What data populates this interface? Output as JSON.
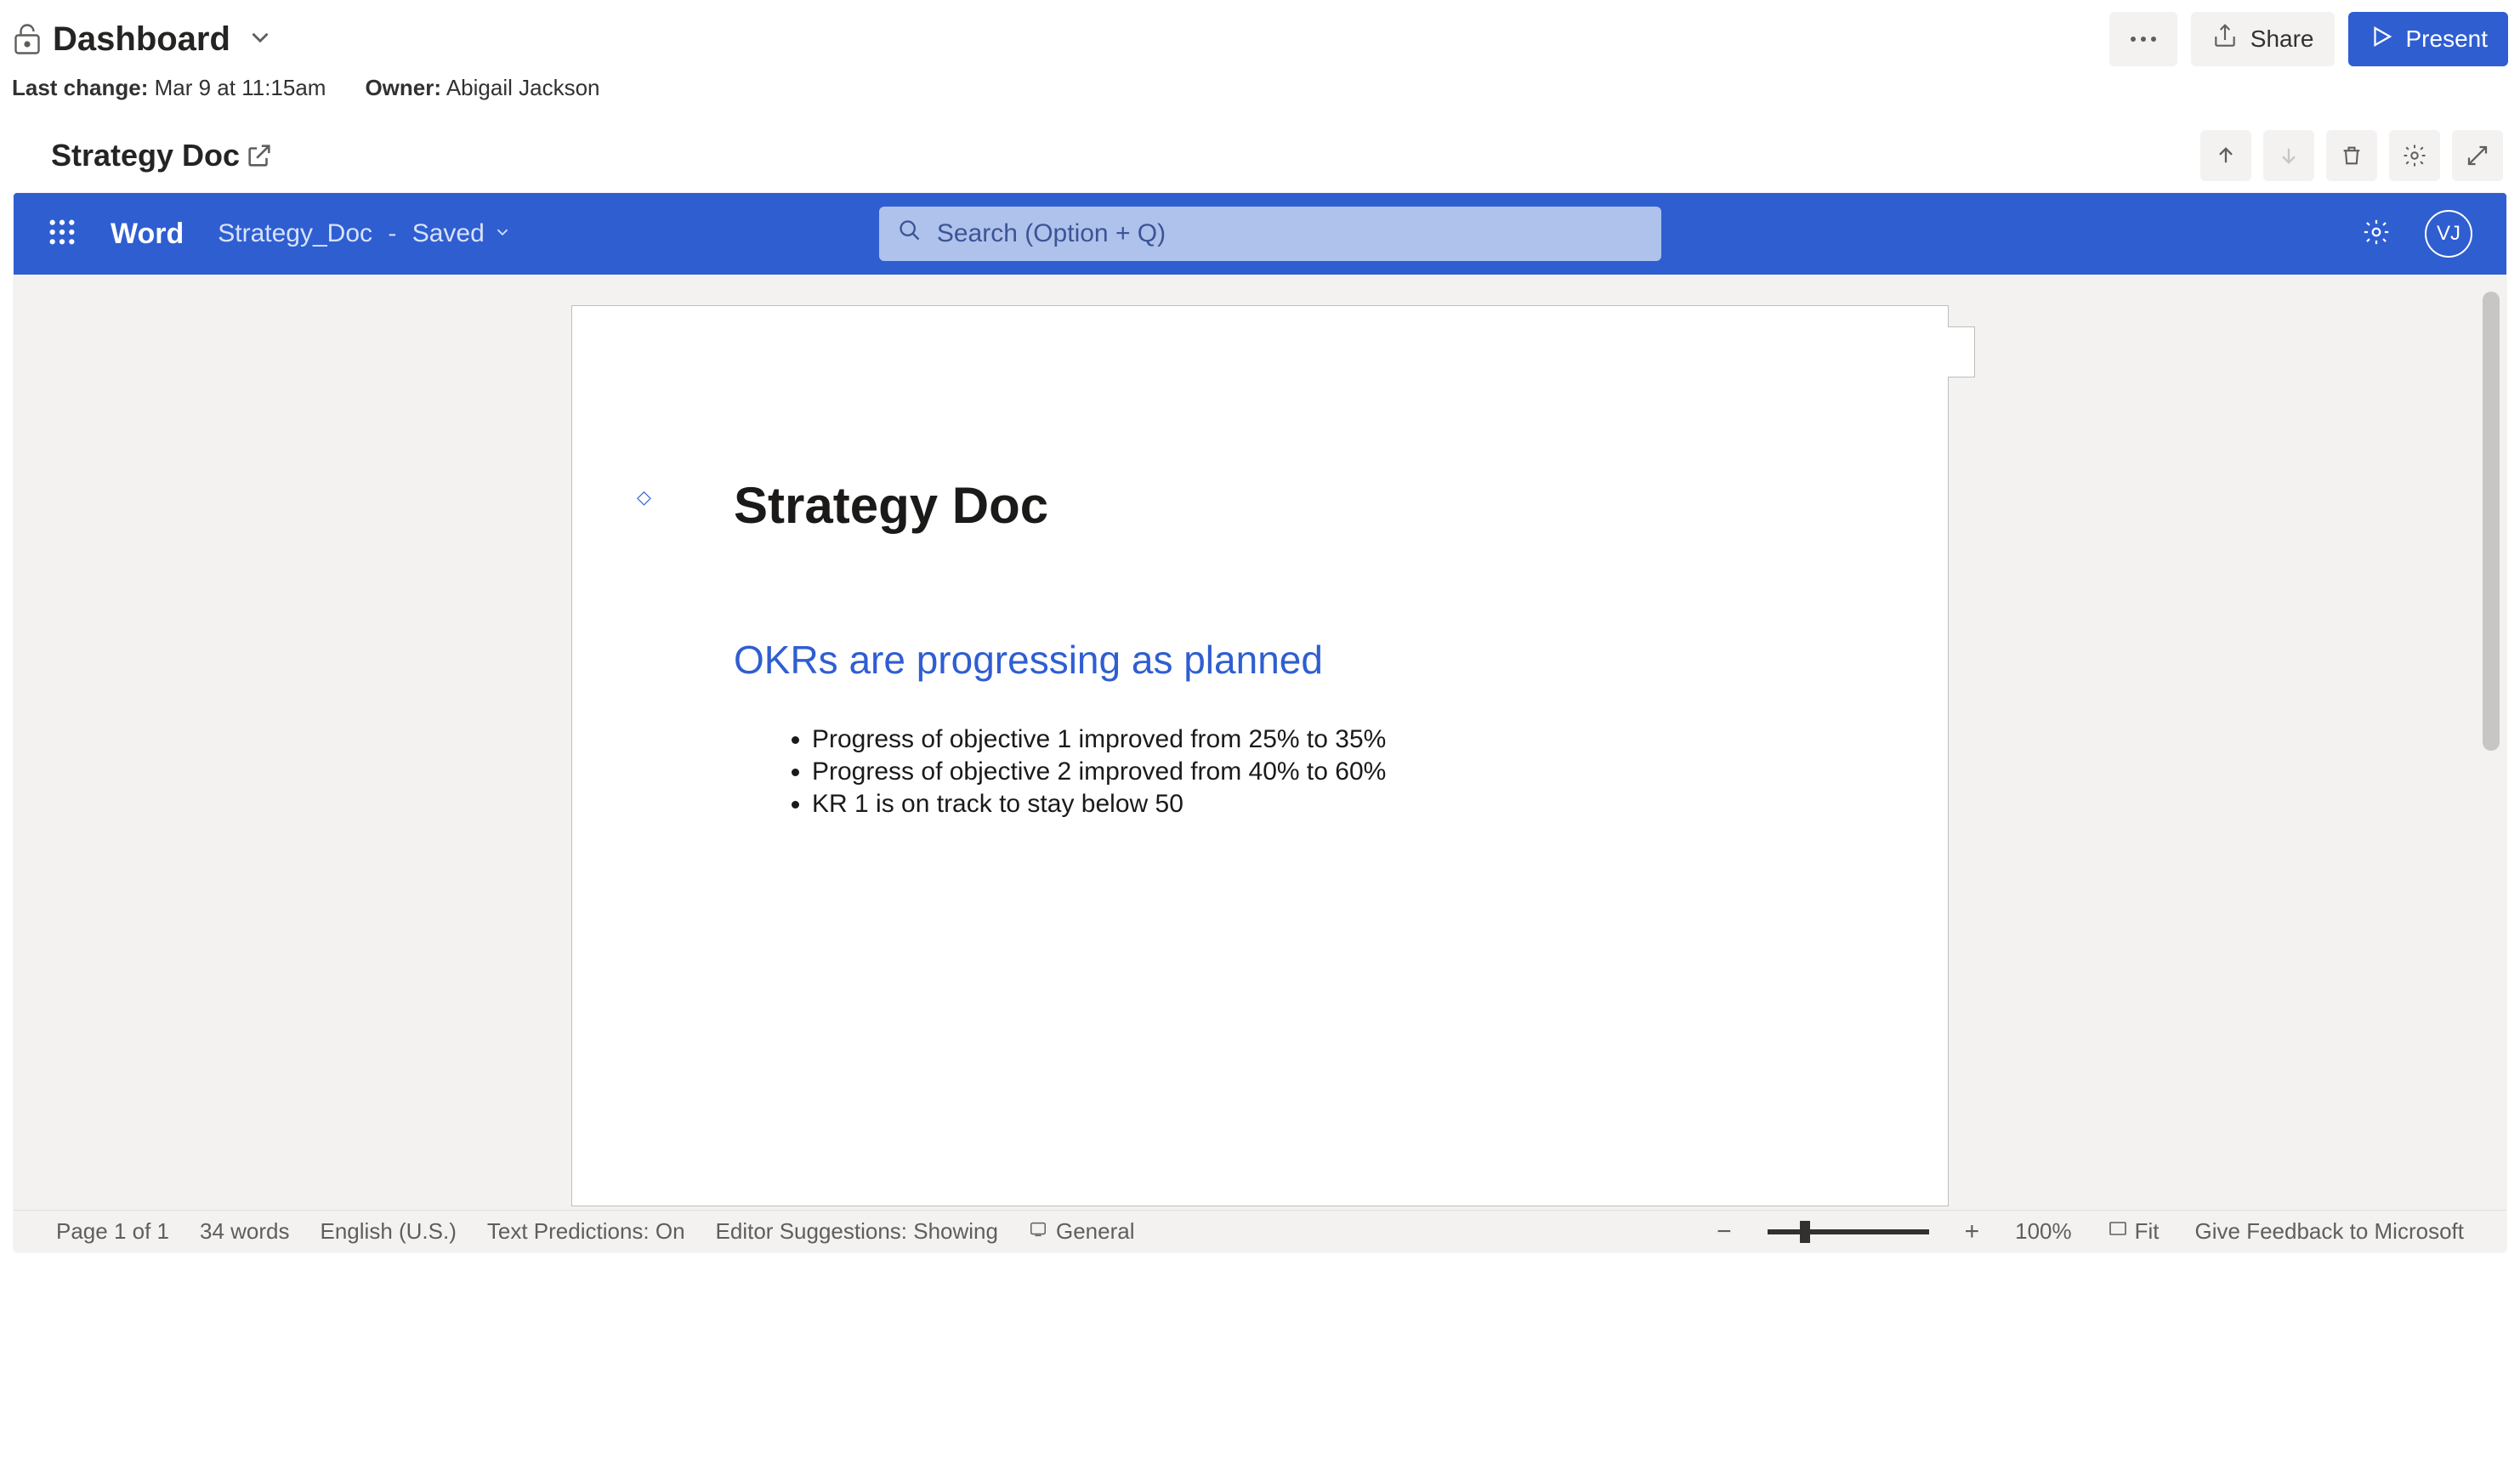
{
  "dashboard": {
    "title": "Dashboard",
    "last_change_label": "Last change:",
    "last_change_value": "Mar 9 at 11:15am",
    "owner_label": "Owner:",
    "owner_value": "Abigail Jackson",
    "share_label": "Share",
    "present_label": "Present"
  },
  "card": {
    "title": "Strategy Doc"
  },
  "word": {
    "brand": "Word",
    "filename": "Strategy_Doc",
    "save_state": "Saved",
    "search_placeholder": "Search (Option + Q)",
    "avatar_initials": "VJ"
  },
  "document": {
    "title": "Strategy Doc",
    "heading": "OKRs are progressing as planned",
    "bullets": [
      "Progress of objective 1 improved from 25% to 35%",
      "Progress of objective 2 improved from 40% to 60%",
      "KR 1 is on track to stay below 50"
    ]
  },
  "status": {
    "page": "Page 1 of 1",
    "words": "34 words",
    "language": "English (U.S.)",
    "predictions": "Text Predictions: On",
    "editor": "Editor Suggestions: Showing",
    "channel": "General",
    "zoom_pct": "100%",
    "fit": "Fit",
    "feedback": "Give Feedback to Microsoft"
  }
}
